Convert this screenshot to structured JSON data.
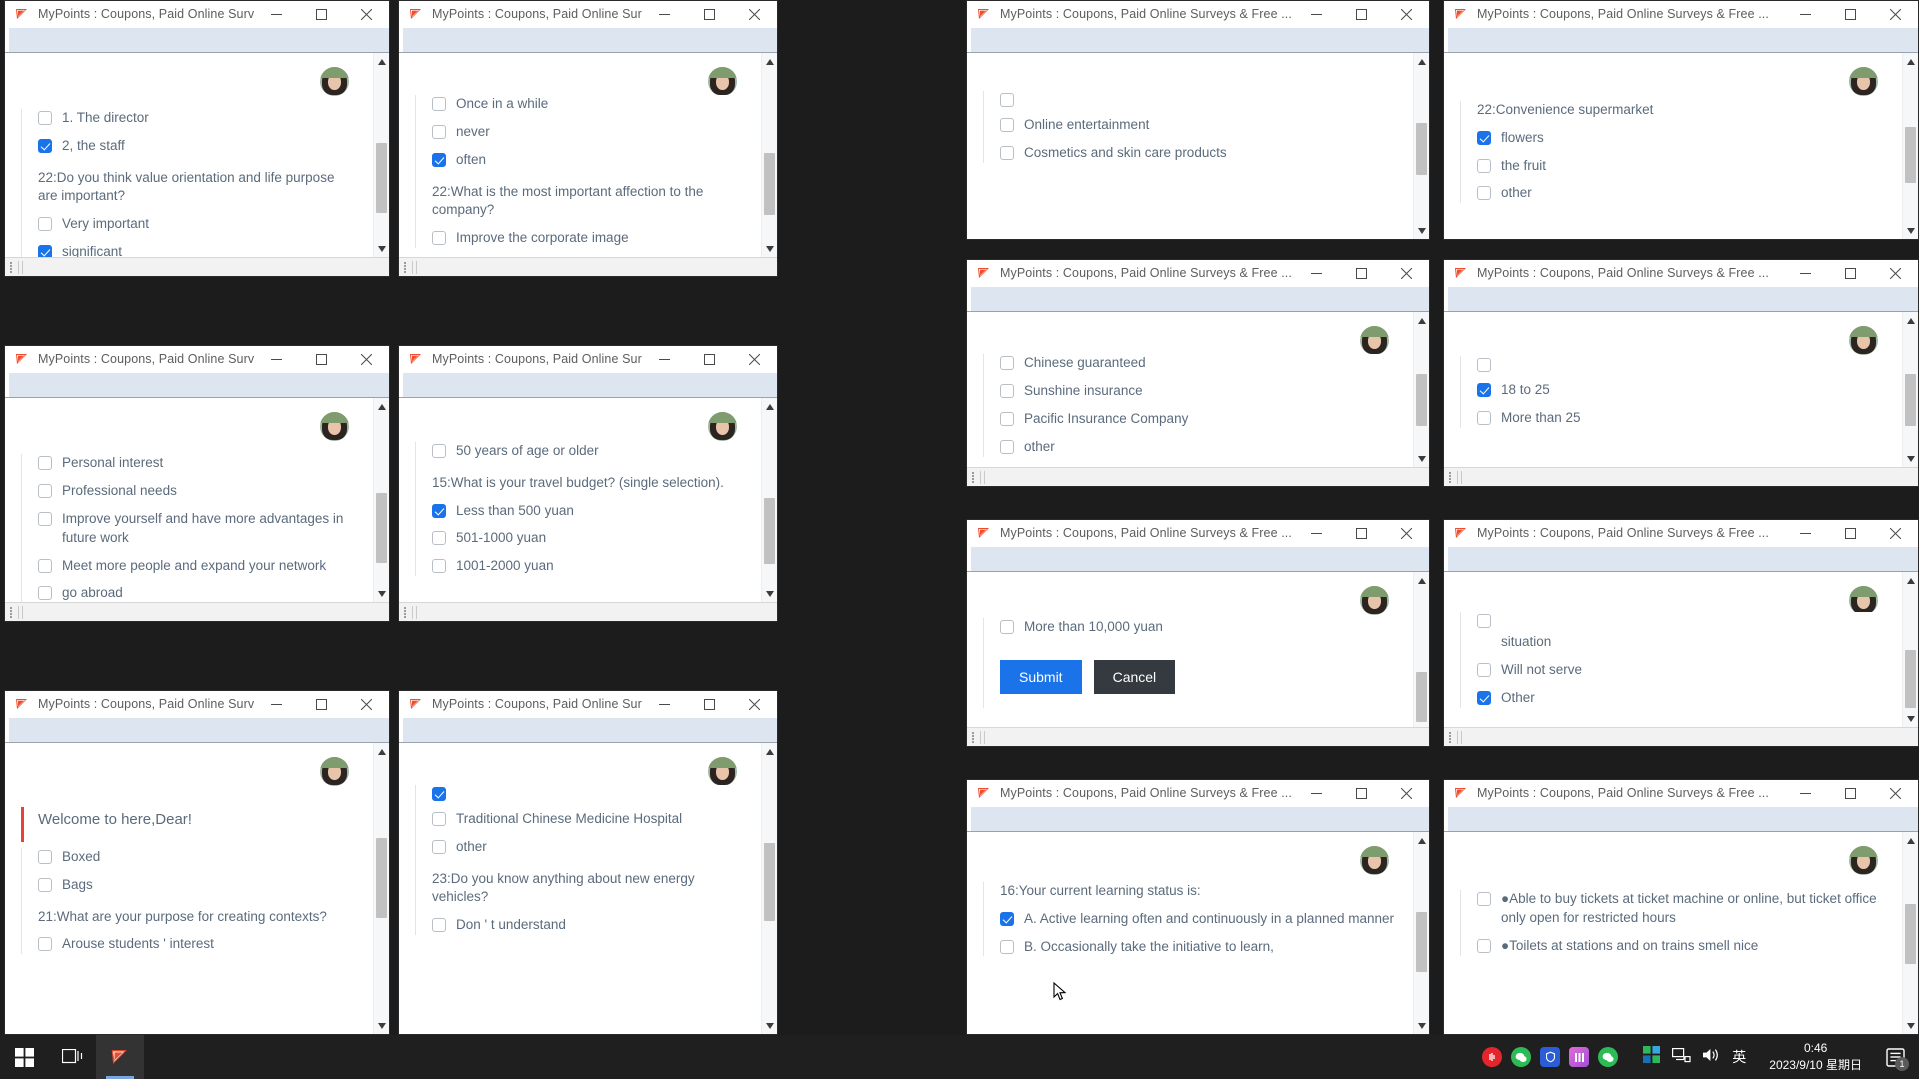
{
  "window_title": "MyPoints : Coupons, Paid Online Surveys & Free ...",
  "colors": {
    "accent": "#1a73e8",
    "cancel": "#343a40",
    "bluebar": "#dde6f0",
    "text": "#5b6b7c",
    "taskbar": "#1f1f1f"
  },
  "controls": {
    "minimize": "minimize",
    "maximize": "maximize",
    "close": "close"
  },
  "windows": [
    {
      "id": "w1",
      "items": [
        {
          "type": "option",
          "label": "1. The director",
          "checked": false
        },
        {
          "type": "option",
          "label": "2, the staff",
          "checked": true
        },
        {
          "type": "question",
          "label": "22:Do you think value orientation and life purpose are important?"
        },
        {
          "type": "option",
          "label": "Very important",
          "checked": false
        },
        {
          "type": "option",
          "label": "significant",
          "checked": true
        }
      ]
    },
    {
      "id": "w2",
      "items": [
        {
          "type": "option",
          "label": "Once in a while",
          "checked": false
        },
        {
          "type": "option",
          "label": "never",
          "checked": false
        },
        {
          "type": "option",
          "label": "often",
          "checked": true
        },
        {
          "type": "question",
          "label": "22:What is the most important affection to the company?"
        },
        {
          "type": "option",
          "label": "Improve the corporate image",
          "checked": false
        }
      ]
    },
    {
      "id": "w3",
      "items": [
        {
          "type": "option",
          "label": "",
          "checked": false
        },
        {
          "type": "option",
          "label": "Online entertainment",
          "checked": false
        },
        {
          "type": "option",
          "label": "Cosmetics and skin care products",
          "checked": false
        }
      ]
    },
    {
      "id": "w4",
      "items": [
        {
          "type": "question",
          "label": "22:Convenience supermarket"
        },
        {
          "type": "option",
          "label": "flowers",
          "checked": true
        },
        {
          "type": "option",
          "label": "the fruit",
          "checked": false
        },
        {
          "type": "option",
          "label": "other",
          "checked": false
        }
      ]
    },
    {
      "id": "w5",
      "items": [
        {
          "type": "option",
          "label": "Personal interest",
          "checked": false
        },
        {
          "type": "option",
          "label": "Professional needs",
          "checked": false
        },
        {
          "type": "option",
          "label": "Improve yourself and have more advantages in future work",
          "checked": false
        },
        {
          "type": "option",
          "label": "Meet more people and expand your network",
          "checked": false
        },
        {
          "type": "option",
          "label": "go abroad",
          "checked": false
        }
      ]
    },
    {
      "id": "w6",
      "items": [
        {
          "type": "option",
          "label": "50 years of age or older",
          "checked": false
        },
        {
          "type": "question",
          "label": "15:What is your travel budget? (single selection)."
        },
        {
          "type": "option",
          "label": "Less than 500 yuan",
          "checked": true
        },
        {
          "type": "option",
          "label": "501-1000 yuan",
          "checked": false
        },
        {
          "type": "option",
          "label": "1001-2000 yuan",
          "checked": false
        }
      ]
    },
    {
      "id": "w7",
      "items": [
        {
          "type": "option",
          "label": "Chinese guaranteed",
          "checked": false
        },
        {
          "type": "option",
          "label": "Sunshine insurance",
          "checked": false
        },
        {
          "type": "option",
          "label": "Pacific Insurance Company",
          "checked": false
        },
        {
          "type": "option",
          "label": "other",
          "checked": false
        }
      ]
    },
    {
      "id": "w8",
      "items": [
        {
          "type": "option",
          "label": "",
          "checked": false
        },
        {
          "type": "option",
          "label": "18 to 25",
          "checked": true
        },
        {
          "type": "option",
          "label": "More than 25",
          "checked": false
        }
      ]
    },
    {
      "id": "w9",
      "items": [
        {
          "type": "option",
          "label": "More than 10,000 yuan",
          "checked": false
        }
      ],
      "buttons": {
        "submit": "Submit",
        "cancel": "Cancel"
      }
    },
    {
      "id": "w10",
      "items": [
        {
          "type": "option",
          "label": "",
          "checked": false
        },
        {
          "type": "text",
          "label": "situation"
        },
        {
          "type": "option",
          "label": "Will not serve",
          "checked": false
        },
        {
          "type": "option",
          "label": "Other",
          "checked": true
        }
      ]
    },
    {
      "id": "w11",
      "items": [
        {
          "type": "welcome",
          "label": "Welcome to here,Dear!"
        },
        {
          "type": "option",
          "label": "Boxed",
          "checked": false
        },
        {
          "type": "option",
          "label": "Bags",
          "checked": false
        },
        {
          "type": "question",
          "label": "21:What are your purpose for creating contexts?"
        },
        {
          "type": "option",
          "label": "Arouse students ' interest",
          "checked": false
        }
      ]
    },
    {
      "id": "w12",
      "items": [
        {
          "type": "option",
          "label": "",
          "checked": true
        },
        {
          "type": "option",
          "label": "Traditional Chinese Medicine Hospital",
          "checked": false
        },
        {
          "type": "option",
          "label": "other",
          "checked": false
        },
        {
          "type": "question",
          "label": "23:Do you know anything about new energy vehicles?"
        },
        {
          "type": "option",
          "label": "Don ' t understand",
          "checked": false
        }
      ]
    },
    {
      "id": "w13",
      "items": [
        {
          "type": "question",
          "label": "16:Your current learning status is:"
        },
        {
          "type": "option",
          "label": "A. Active learning often and continuously in a planned manner",
          "checked": true
        },
        {
          "type": "option",
          "label": "B. Occasionally take the initiative to learn,",
          "checked": false
        }
      ]
    },
    {
      "id": "w14",
      "items": [
        {
          "type": "option",
          "label": "●Able to buy tickets at ticket machine or online, but ticket office only open for restricted hours",
          "checked": false
        },
        {
          "type": "option",
          "label": "●Toilets at stations and on trains smell nice",
          "checked": false
        }
      ]
    }
  ],
  "taskbar": {
    "start_icon": "windows-start-icon",
    "taskview_icon": "task-view-icon",
    "app_icon": "mypoints-app-icon",
    "tray_icons": [
      "netease-music-icon",
      "wechat-icon",
      "security-shield-icon",
      "app-pink-icon",
      "wechat2-icon"
    ],
    "system_icons": [
      "colorful-tiles-icon",
      "network-icon",
      "volume-icon"
    ],
    "ime": "英",
    "time": "0:46",
    "date": "2023/9/10 星期日",
    "notification_count": "1"
  }
}
